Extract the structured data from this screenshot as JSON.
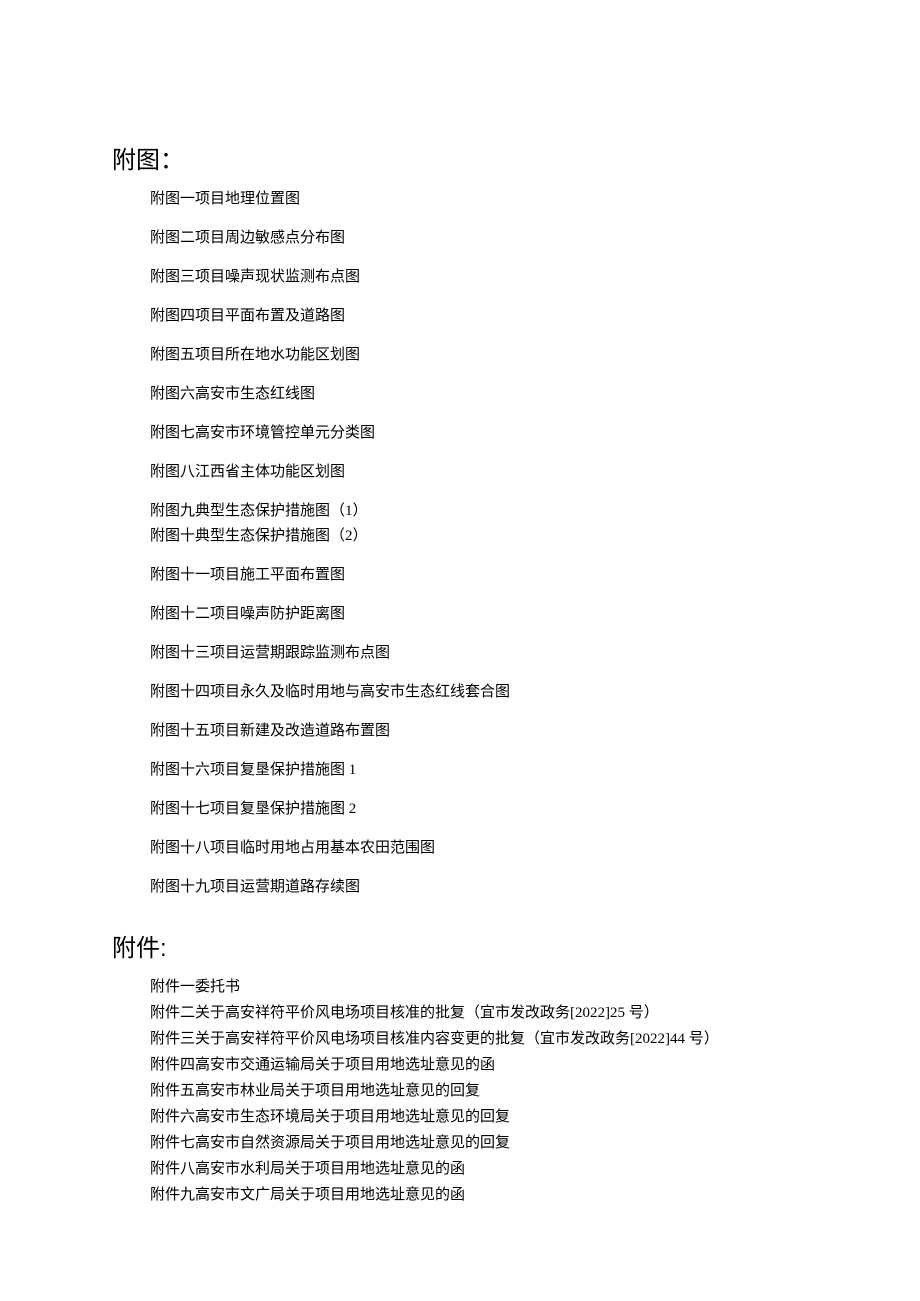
{
  "headings": {
    "figures": "附图：",
    "attachments": "附件:"
  },
  "figures": [
    "附图一项目地理位置图",
    "附图二项目周边敏感点分布图",
    "附图三项目噪声现状监测布点图",
    "附图四项目平面布置及道路图",
    "附图五项目所在地水功能区划图",
    "附图六高安市生态红线图",
    "附图七高安市环境管控单元分类图",
    "附图八江西省主体功能区划图",
    "附图九典型生态保护措施图（1）",
    "附图十典型生态保护措施图（2）",
    "附图十一项目施工平面布置图",
    "附图十二项目噪声防护距离图",
    "附图十三项目运营期跟踪监测布点图",
    "附图十四项目永久及临时用地与高安市生态红线套合图",
    "附图十五项目新建及改造道路布置图",
    "附图十六项目复垦保护措施图 1",
    "附图十七项目复垦保护措施图 2",
    "附图十八项目临时用地占用基本农田范围图",
    "附图十九项目运营期道路存续图"
  ],
  "attachments": [
    "附件一委托书",
    "附件二关于高安祥符平价风电场项目核准的批复（宜市发改政务[2022]25 号）",
    "附件三关于高安祥符平价风电场项目核准内容变更的批复（宜市发改政务[2022]44 号）",
    "附件四高安市交通运输局关于项目用地选址意见的函",
    "附件五高安市林业局关于项目用地选址意见的回复",
    "附件六高安市生态环境局关于项目用地选址意见的回复",
    "附件七高安市自然资源局关于项目用地选址意见的回复",
    "附件八高安市水利局关于项目用地选址意见的函",
    "附件九高安市文广局关于项目用地选址意见的函"
  ]
}
